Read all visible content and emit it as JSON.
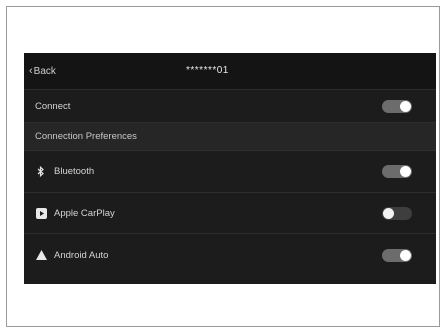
{
  "header": {
    "back_label": "Back",
    "device_name": "*******01"
  },
  "connect": {
    "label": "Connect",
    "enabled": true
  },
  "preferences": {
    "section_label": "Connection Preferences",
    "items": [
      {
        "label": "Bluetooth",
        "icon": "bluetooth-icon",
        "enabled": true
      },
      {
        "label": "Apple CarPlay",
        "icon": "carplay-icon",
        "enabled": false
      },
      {
        "label": "Android Auto",
        "icon": "android-auto-icon",
        "enabled": true
      }
    ]
  },
  "colors": {
    "screen_bg": "#1c1c1c",
    "toggle_on": "#6c6c6c",
    "toggle_off": "#3e3e3e"
  }
}
